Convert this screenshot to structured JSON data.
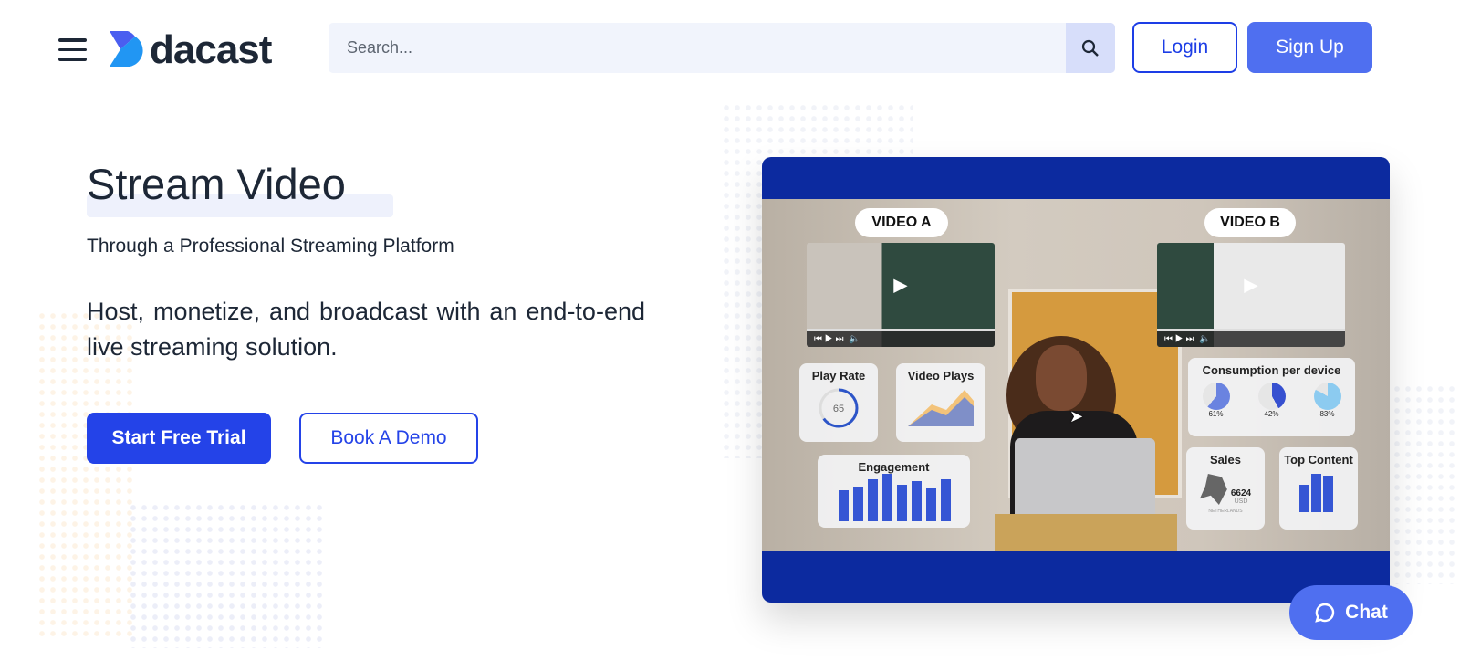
{
  "header": {
    "logo_text": "dacast",
    "search_placeholder": "Search...",
    "login_label": "Login",
    "signup_label": "Sign Up"
  },
  "hero": {
    "title": "Stream Video",
    "subtitle": "Through a Professional Streaming Platform",
    "description": "Host, monetize, and broadcast with an end-to-end live streaming solution.",
    "primary_cta": "Start Free Trial",
    "secondary_cta": "Book A Demo"
  },
  "video": {
    "label_a": "VIDEO A",
    "label_b": "VIDEO B",
    "play_rate": {
      "title": "Play Rate",
      "value": "65",
      "unit": "%"
    },
    "video_plays": {
      "title": "Video Plays"
    },
    "engagement": {
      "title": "Engagement"
    },
    "consumption": {
      "title": "Consumption per device",
      "values": [
        "61%",
        "42%",
        "83%"
      ]
    },
    "sales": {
      "title": "Sales",
      "value": "6624",
      "unit": "USD",
      "region": "NETHERLANDS"
    },
    "top_content": {
      "title": "Top Content"
    }
  },
  "chat": {
    "label": "Chat"
  },
  "colors": {
    "brand": "#2443e8",
    "accent": "#4f6ff0",
    "navy": "#0c2a9f",
    "text": "#1d2736"
  }
}
